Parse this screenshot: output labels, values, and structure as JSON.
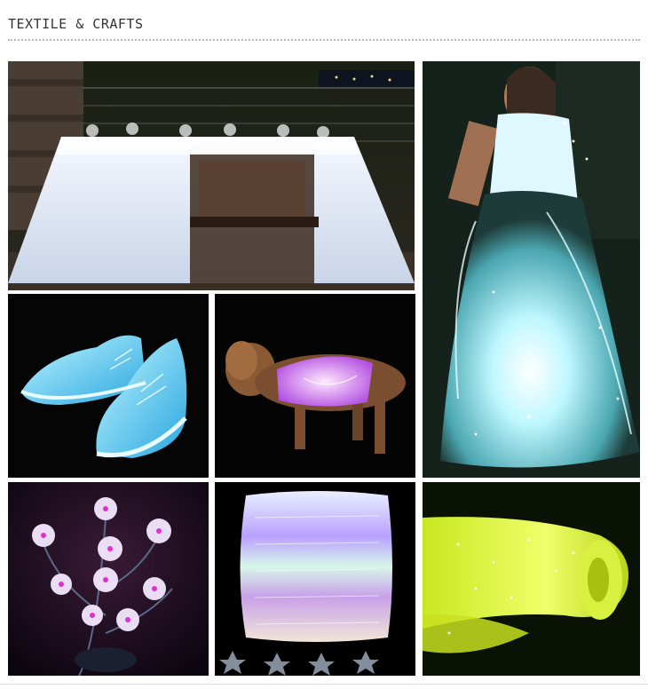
{
  "header": {
    "title": "TEXTILE & CRAFTS"
  },
  "gallery": {
    "items": [
      {
        "icon": "luminous-tablecloth-photo"
      },
      {
        "icon": "luminous-wedding-dress-photo"
      },
      {
        "icon": "luminous-sneakers-photo"
      },
      {
        "icon": "luminous-dog-vest-photo"
      },
      {
        "icon": "luminous-flower-lamp-photo"
      },
      {
        "icon": "luminous-pillow-photo"
      },
      {
        "icon": "luminous-fabric-roll-photo"
      }
    ]
  },
  "colors": {
    "title": "#333333",
    "divider": "#b8b8b8",
    "tile_background": "#000000",
    "glow_cyan": "#7fe8ff",
    "glow_purple": "#c070ff",
    "glow_yellow": "#e8ff40"
  }
}
